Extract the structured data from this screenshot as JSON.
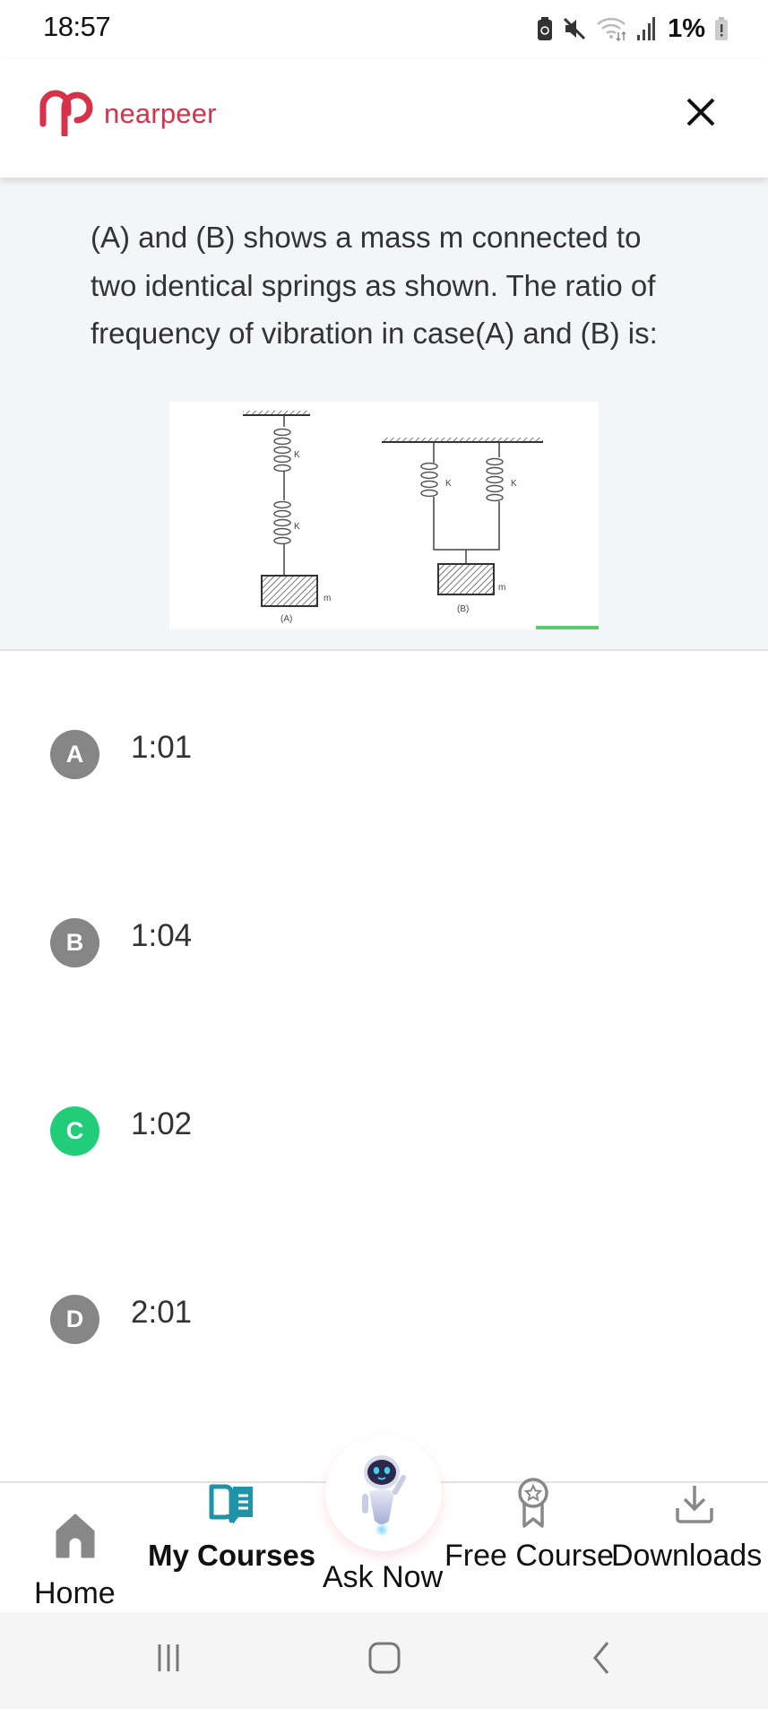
{
  "status_bar": {
    "time": "18:57",
    "battery_percent": "1%",
    "icons": [
      "battery-saver-icon",
      "mute-icon",
      "wifi-icon",
      "signal-icon",
      "battery-low-icon"
    ]
  },
  "header": {
    "brand_name": "nearpeer",
    "brand_color": "#d8314a",
    "close_icon": "close-icon"
  },
  "question": {
    "text": "(A) and (B) shows a mass m connected to two identical springs as shown. The ratio of frequency of vibration in case(A) and (B) is:",
    "diagram": {
      "spring_label": "K",
      "mass_label": "m",
      "caption_a": "(A)",
      "caption_b": "(B)"
    }
  },
  "options": [
    {
      "letter": "A",
      "text": "1:01",
      "state": "neutral"
    },
    {
      "letter": "B",
      "text": "1:04",
      "state": "neutral"
    },
    {
      "letter": "C",
      "text": "1:02",
      "state": "correct"
    },
    {
      "letter": "D",
      "text": "2:01",
      "state": "neutral"
    }
  ],
  "colors": {
    "correct": "#22cd7a",
    "neutral_badge": "#868686",
    "nav_active": "#1f93a8",
    "nav_inactive": "#888888"
  },
  "bottom_nav": {
    "items": [
      {
        "label": "Home",
        "icon": "home-icon"
      },
      {
        "label": "My Courses",
        "icon": "book-icon",
        "active": true
      },
      {
        "label": "Ask Now",
        "icon": "robot-icon"
      },
      {
        "label": "Free Course",
        "icon": "award-icon"
      },
      {
        "label": "Downloads",
        "icon": "download-icon"
      }
    ]
  },
  "system_nav": {
    "buttons": [
      "recents-icon",
      "home-button-icon",
      "back-icon"
    ]
  }
}
